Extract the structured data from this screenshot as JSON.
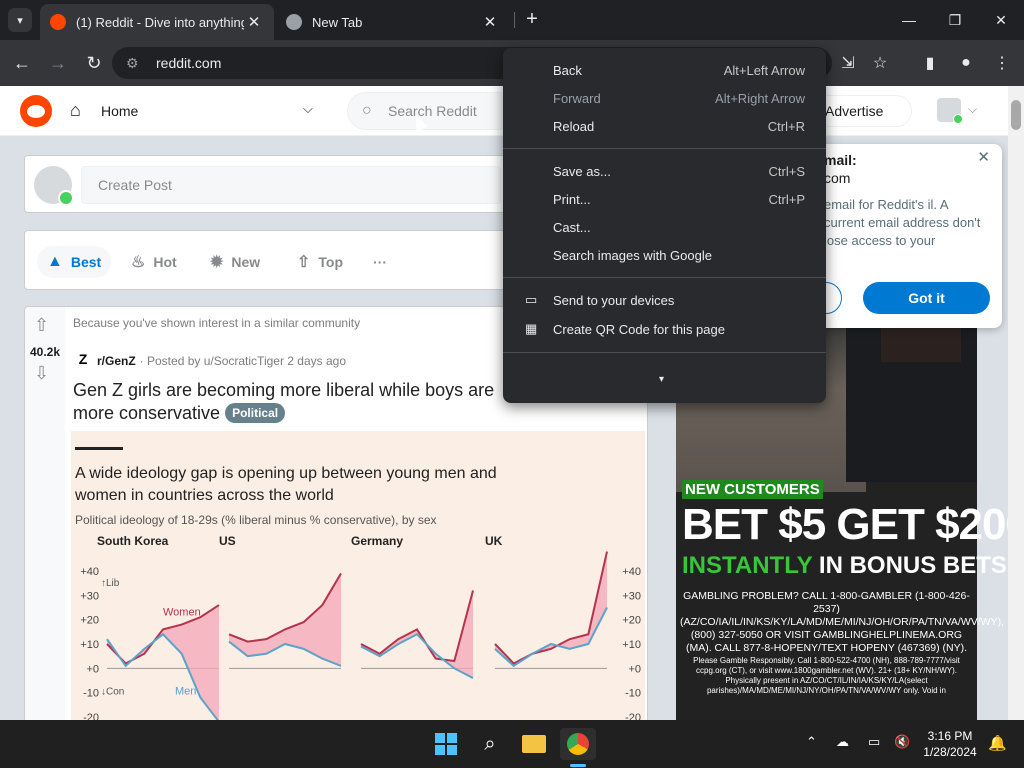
{
  "browser": {
    "tabs": [
      {
        "title": "(1) Reddit - Dive into anything",
        "active": true
      },
      {
        "title": "New Tab",
        "active": false
      }
    ],
    "url": "reddit.com"
  },
  "header": {
    "home_label": "Home",
    "search_placeholder": "Search Reddit",
    "advertise_label": "Advertise"
  },
  "create_post": {
    "placeholder": "Create Post"
  },
  "sort_tabs": [
    {
      "label": "Best"
    },
    {
      "label": "Hot"
    },
    {
      "label": "New"
    },
    {
      "label": "Top"
    },
    {
      "label": "···"
    }
  ],
  "post": {
    "reason": "Because you've shown interest in a similar community",
    "score": "40.2k",
    "subreddit": "r/GenZ",
    "posted_by": "· Posted by u/SocraticTiger 2 days ago",
    "title": "Gen Z girls are becoming more liberal while boys are more conservative",
    "flair": "Political"
  },
  "chart_data": {
    "type": "line",
    "title": "A wide ideology gap is opening up between young men and women in countries across the world",
    "subtitle": "Political ideology of 18-29s (% liberal minus % conservative), by sex",
    "panels": [
      "South Korea",
      "US",
      "Germany",
      "UK"
    ],
    "y_ticks": [
      "+40",
      "+30",
      "+20",
      "+10",
      "+0",
      "-10",
      "-20"
    ],
    "ylim": [
      -20,
      40
    ],
    "left_labels": {
      "top": "↑Lib",
      "bottom": "↓Con"
    },
    "series": [
      {
        "name": "Women",
        "color": "#b5334d"
      },
      {
        "name": "Men",
        "color": "#5ba3c9"
      }
    ],
    "panel_series": [
      {
        "women": [
          10,
          2,
          6,
          16,
          18,
          21,
          26
        ],
        "men": [
          12,
          1,
          8,
          14,
          6,
          -12,
          -22
        ]
      },
      {
        "women": [
          14,
          11,
          12,
          16,
          19,
          26,
          39
        ],
        "men": [
          11,
          5,
          6,
          10,
          8,
          4,
          1
        ]
      },
      {
        "women": [
          10,
          6,
          12,
          16,
          4,
          3,
          32
        ],
        "men": [
          9,
          5,
          10,
          14,
          6,
          0,
          -4
        ]
      },
      {
        "women": [
          10,
          2,
          6,
          8,
          12,
          14,
          48
        ],
        "men": [
          8,
          1,
          6,
          10,
          8,
          10,
          25
        ]
      }
    ]
  },
  "ad": {
    "tag": "NEW CUSTOMERS",
    "headline": "BET $5 GET $200",
    "instant": "INSTANTLY",
    "bonus": " IN BONUS BETS",
    "fine1": "GAMBLING PROBLEM? CALL 1-800-GAMBLER (1-800-426-2537) (AZ/CO/IA/IL/IN/KS/KY/LA/MD/ME/MI/NJ/OH/OR/PA/TN/VA/WV/WY), (800) 327-5050 OR VISIT GAMBLINGHELPLINEMA.ORG (MA). CALL 877-8-HOPENY/TEXT HOPENY (467369) (NY).",
    "fine2": "Please Gamble Responsibly. Call 1-800-522-4700 (NH), 888-789-7777/visit ccpg.org (CT), or visit www.1800gambler.net (WV). 21+ (18+ KY/NH/WY). Physically present in AZ/CO/CT/IL/IN/IA/KS/KY/LA(select parishes)/MA/MD/ME/MI/NJ/NY/OH/PA/TN/VA/WV/WY only. Void in"
  },
  "email_popup": {
    "line1": "mail:",
    "line2": "com",
    "body": "email for Reddit's il. A current email address don't lose access to your",
    "left_button": "ail",
    "got_it": "Got it"
  },
  "context_menu": {
    "items": [
      {
        "label": "Back",
        "shortcut": "Alt+Left Arrow",
        "disabled": false
      },
      {
        "label": "Forward",
        "shortcut": "Alt+Right Arrow",
        "disabled": true
      },
      {
        "label": "Reload",
        "shortcut": "Ctrl+R",
        "disabled": false
      },
      {
        "label": "Save as...",
        "shortcut": "Ctrl+S",
        "disabled": false
      },
      {
        "label": "Print...",
        "shortcut": "Ctrl+P",
        "disabled": false
      },
      {
        "label": "Cast...",
        "shortcut": "",
        "disabled": false
      },
      {
        "label": "Search images with Google",
        "shortcut": "",
        "disabled": false
      },
      {
        "label": "Send to your devices",
        "shortcut": "",
        "disabled": false,
        "icon": "laptop-icon"
      },
      {
        "label": "Create QR Code for this page",
        "shortcut": "",
        "disabled": false,
        "icon": "qr-code-icon"
      }
    ],
    "more": "▾"
  },
  "taskbar": {
    "time": "3:16 PM",
    "date": "1/28/2024"
  }
}
